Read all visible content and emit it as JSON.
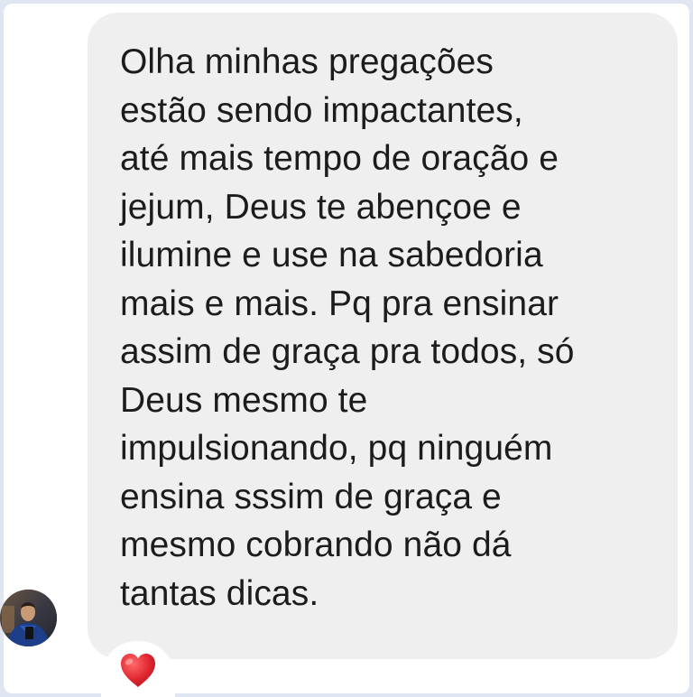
{
  "message": {
    "lines": [
      "Olha minhas pregações",
      "estão sendo impactantes,",
      "até mais tempo de oração e",
      "jejum, Deus te abençoe e",
      "ilumine e use na sabedoria",
      "mais e mais. Pq pra ensinar",
      "assim de graça pra todos, só",
      "Deus mesmo te",
      "impulsionando, pq ninguém",
      "ensina sssim de graça e",
      "mesmo cobrando não dá",
      "tantas dicas."
    ]
  },
  "reaction": {
    "icon": "heart-icon",
    "color": "#e0262f"
  },
  "colors": {
    "bubble": "#efefef",
    "text": "#1c1c1c",
    "frame_border": "#dfe6f2"
  }
}
